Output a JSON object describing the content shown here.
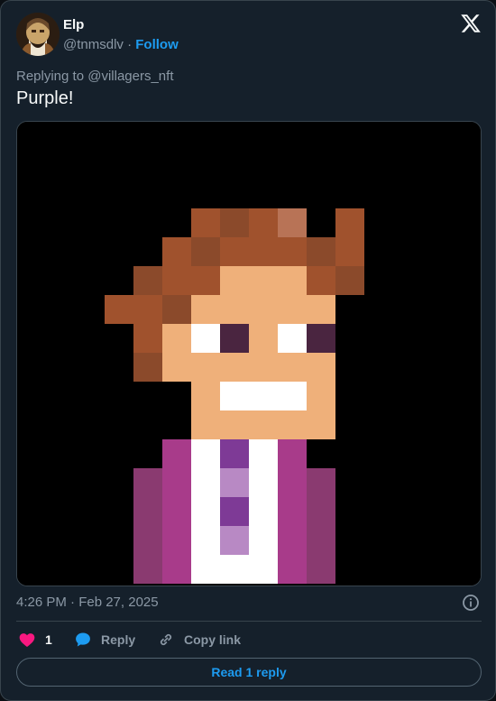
{
  "author": {
    "name": "Elp",
    "handle": "@tnmsdlv",
    "separator": "·",
    "follow_label": "Follow"
  },
  "brand_icon": "x-logo-icon",
  "tweet": {
    "replying_prefix": "Replying to",
    "replying_to": "@villagers_nft",
    "text": "Purple!",
    "media_alt": "pixel art villager character with brown hair and purple jacket",
    "timestamp": "4:26 PM · Feb 27, 2025"
  },
  "actions": {
    "like_count": "1",
    "reply_label": "Reply",
    "copy_link_label": "Copy link"
  },
  "read_replies_label": "Read 1 reply",
  "colors": {
    "background": "#15202b",
    "text": "#f7f9f9",
    "secondary_text": "#8b98a5",
    "accent": "#1d9bf0",
    "like": "#f91880",
    "border": "#38444d"
  }
}
